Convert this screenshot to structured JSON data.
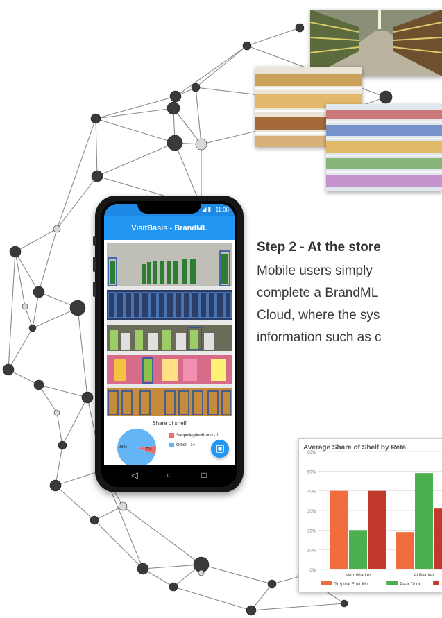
{
  "step": {
    "title": "Step 2 - At the store",
    "lines": [
      "Mobile users simply",
      "complete a BrandML",
      "Cloud, where the sys",
      "information such as c"
    ]
  },
  "phone": {
    "status_time": "11:06",
    "app_title": "VisitBasis - BrandML",
    "share_caption": "Share of shelf",
    "pie": {
      "slices": [
        {
          "label": "SanpellegrinoBrand - 1",
          "pct_text": "7%",
          "value": 7,
          "color": "#f26b6b"
        },
        {
          "label": "Other - 14",
          "pct_text": "93%",
          "value": 93,
          "color": "#64b5f6"
        }
      ]
    },
    "fab_icon": "gallery-icon",
    "nav_icons": [
      "back-icon",
      "home-icon",
      "recents-icon"
    ],
    "nav_glyphs": [
      "◁",
      "○",
      "□"
    ]
  },
  "chart_data": {
    "type": "bar",
    "title": "Average Share of Shelf by Reta",
    "categories": [
      "MetroMarket",
      "AUMarket"
    ],
    "series": [
      {
        "name": "Tropical Fruit Mix",
        "values": [
          40,
          19
        ],
        "color": "#f26d3d"
      },
      {
        "name": "Pear Drink",
        "values": [
          20,
          49
        ],
        "color": "#4caf50"
      },
      {
        "values": [
          40,
          31
        ],
        "color": "#c0392b"
      }
    ],
    "ylim": [
      0,
      60
    ],
    "yticks": [
      "0%",
      "10%",
      "20%",
      "30%",
      "40%",
      "50%",
      "60%"
    ],
    "grid": true,
    "legend": "bottom"
  },
  "colors": {
    "accent": "#2196f3",
    "node_dark": "#3a3a3a",
    "node_light": "#d8d8d8"
  }
}
